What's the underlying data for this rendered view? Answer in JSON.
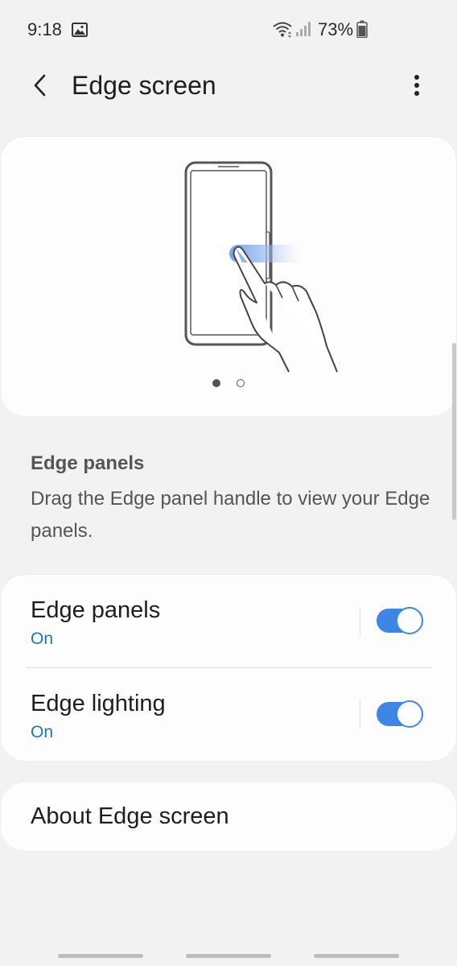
{
  "status_bar": {
    "time": "9:18",
    "battery": "73%",
    "icons": [
      "gallery-icon",
      "wifi-icon",
      "signal-icon",
      "battery-icon"
    ]
  },
  "app_bar": {
    "title": "Edge screen",
    "back_icon": "chevron-left-icon",
    "more_icon": "more-vertical-icon"
  },
  "illustration": {
    "description_icon": "phone-edge-swipe-illustration",
    "pages": 2,
    "current_page": 1
  },
  "section": {
    "heading": "Edge panels",
    "description": "Drag the Edge panel handle to view your Edge panels."
  },
  "settings": [
    {
      "title": "Edge panels",
      "status": "On",
      "enabled": true
    },
    {
      "title": "Edge lighting",
      "status": "On",
      "enabled": true
    }
  ],
  "about": {
    "label": "About Edge screen"
  },
  "colors": {
    "background": "#f2f2f2",
    "card": "#fdfdfd",
    "accent": "#3e86e6",
    "status_on": "#1a77b8",
    "secondary_text": "#555555"
  }
}
